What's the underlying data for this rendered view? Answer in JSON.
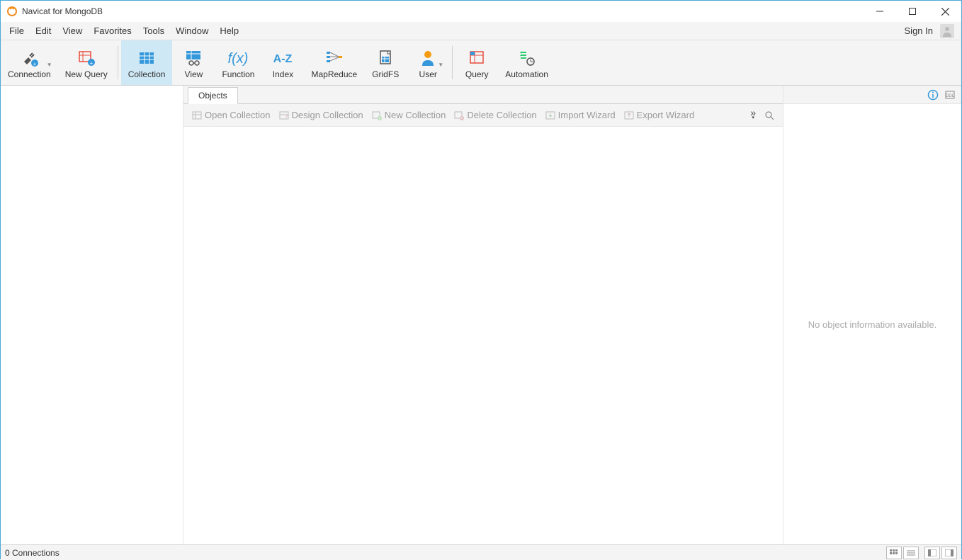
{
  "window": {
    "title": "Navicat for MongoDB"
  },
  "menubar": {
    "items": [
      "File",
      "Edit",
      "View",
      "Favorites",
      "Tools",
      "Window",
      "Help"
    ],
    "signin": "Sign In"
  },
  "toolbar": {
    "connection": "Connection",
    "new_query": "New Query",
    "collection": "Collection",
    "view": "View",
    "function": "Function",
    "index": "Index",
    "mapreduce": "MapReduce",
    "gridfs": "GridFS",
    "user": "User",
    "query": "Query",
    "automation": "Automation"
  },
  "tabs": {
    "objects": "Objects"
  },
  "subtoolbar": {
    "open": "Open Collection",
    "design": "Design Collection",
    "new": "New Collection",
    "delete": "Delete Collection",
    "import": "Import Wizard",
    "export": "Export Wizard"
  },
  "rightpanel": {
    "message": "No object information available."
  },
  "statusbar": {
    "connections": "0 Connections"
  }
}
